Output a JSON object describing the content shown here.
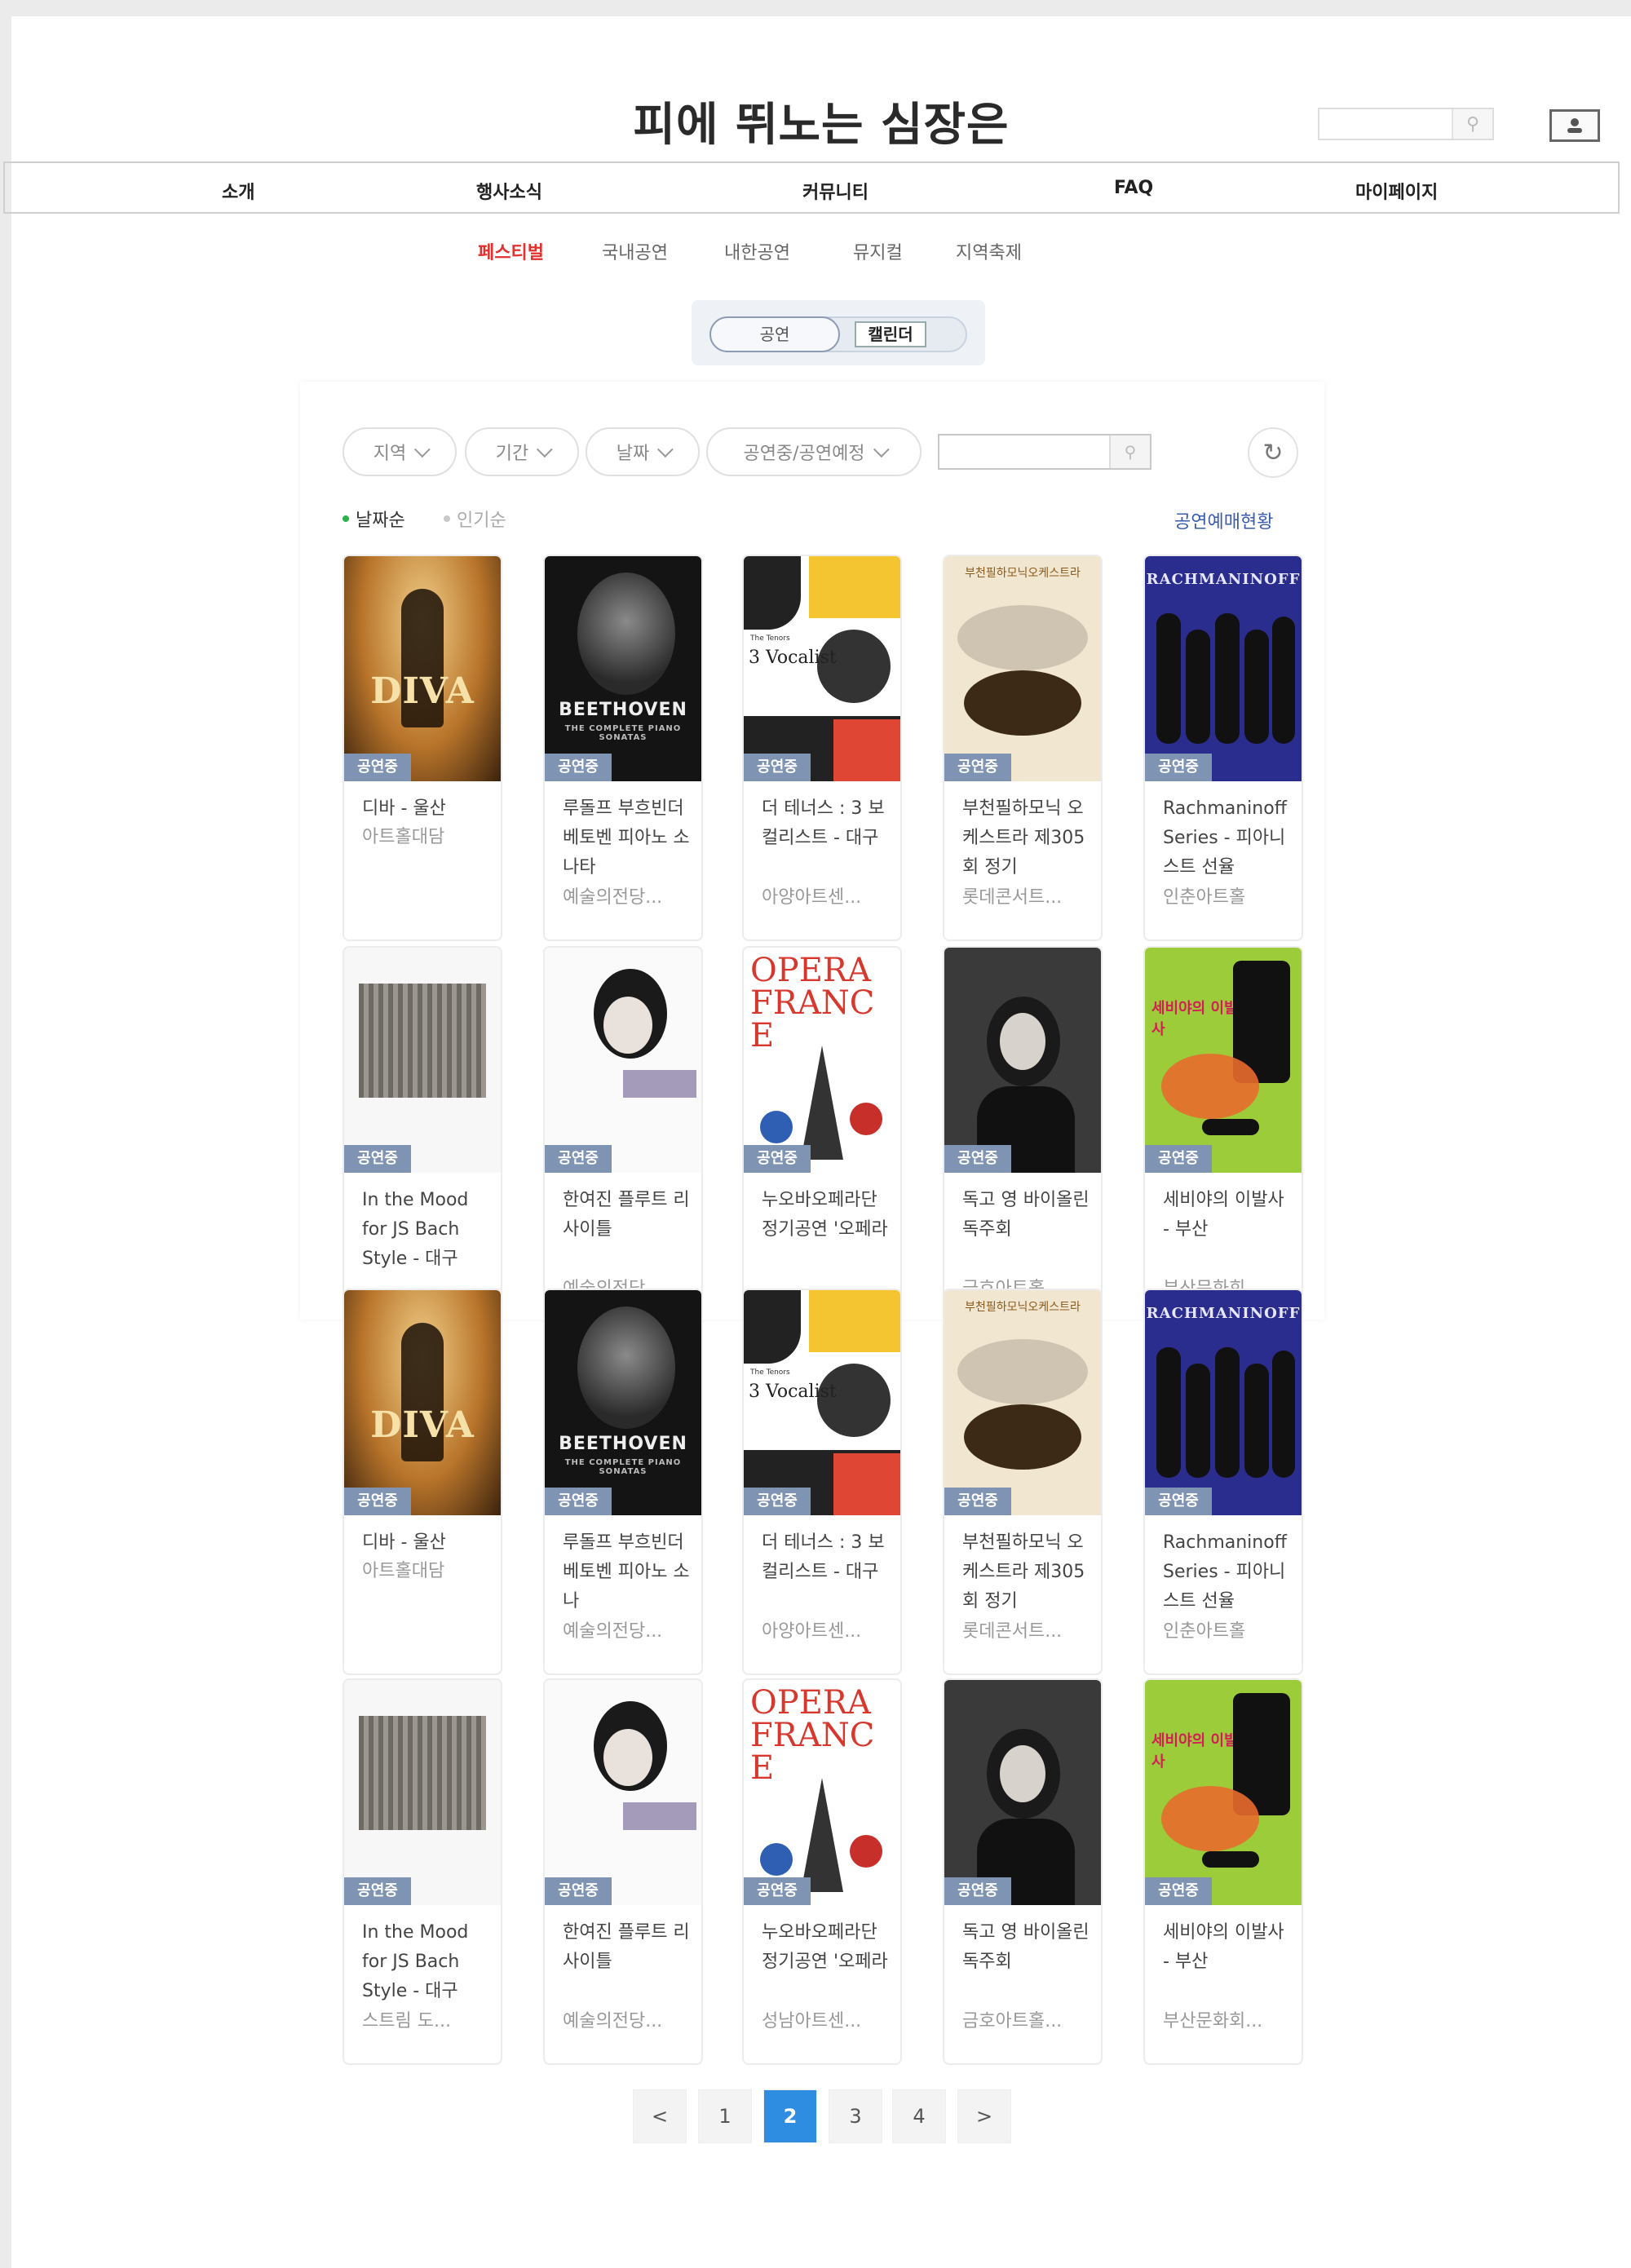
{
  "header": {
    "site_title": "피에 뛰노는 심장은"
  },
  "gnb": [
    "소개",
    "행사소식",
    "커뮤니티",
    "FAQ",
    "마이페이지"
  ],
  "subnav": {
    "items": [
      "페스티벌",
      "국내공연",
      "내한공연",
      "뮤지컬",
      "지역축제"
    ],
    "active_index": 0
  },
  "view_toggle": {
    "on": "공연",
    "off": "캘린더"
  },
  "filters": {
    "region": "지역",
    "period": "기간",
    "date": "날짜",
    "status": "공연중/공연예정"
  },
  "sort": {
    "by_date": "날짜순",
    "by_popularity": "인기순"
  },
  "status_link": "공연예매현황",
  "cards": [
    {
      "title": "디바 - 울산",
      "venue": "아트홀대담",
      "badge": "공연중",
      "poster": "diva"
    },
    {
      "title": "루돌프 부흐빈더 베토벤 피아노 소나타",
      "venue": "예술의전당...",
      "badge": "공연중",
      "poster": "beethoven"
    },
    {
      "title": "더 테너스 : 3 보컬리스트 - 대구",
      "venue": "아양아트센...",
      "badge": "공연중",
      "poster": "vocalist"
    },
    {
      "title": "부천필하모닉 오케스트라 제305회 정기",
      "venue": "롯데콘서트...",
      "badge": "공연중",
      "poster": "bucheon"
    },
    {
      "title": "Rachmaninoff Series - 피아니스트 선율",
      "venue": "인춘아트홀",
      "badge": "공연중",
      "poster": "rach"
    },
    {
      "title": "In the Mood for JS Bach Style - 대구",
      "venue": "",
      "badge": "공연중",
      "poster": "bach"
    },
    {
      "title": "한여진 플루트 리사이틀",
      "venue": "예술의전당...",
      "badge": "공연중",
      "poster": "flute"
    },
    {
      "title": "누오바오페라단 정기공연 '오페라",
      "venue": "",
      "badge": "공연중",
      "poster": "opera"
    },
    {
      "title": "독고 영 바이올린 독주회",
      "venue": "금호아트홀...",
      "badge": "공연중",
      "poster": "violin"
    },
    {
      "title": "세비야의 이발사 - 부산",
      "venue": "부산문화회...",
      "badge": "공연중",
      "poster": "seville"
    },
    {
      "title": "디바 - 울산",
      "venue": "아트홀대담",
      "badge": "공연중",
      "poster": "diva"
    },
    {
      "title": "루돌프 부흐빈더 베토벤 피아노 소나",
      "venue": "예술의전당...",
      "badge": "공연중",
      "poster": "beethoven"
    },
    {
      "title": "더 테너스 : 3 보컬리스트 - 대구",
      "venue": "아양아트센...",
      "badge": "공연중",
      "poster": "vocalist"
    },
    {
      "title": "부천필하모닉 오케스트라 제305회 정기",
      "venue": "롯데콘서트...",
      "badge": "공연중",
      "poster": "bucheon"
    },
    {
      "title": "Rachmaninoff Series - 피아니스트 선율",
      "venue": "인춘아트홀",
      "badge": "공연중",
      "poster": "rach"
    },
    {
      "title": "In the Mood for JS Bach Style - 대구",
      "venue": "스트림 도...",
      "badge": "공연중",
      "poster": "bach"
    },
    {
      "title": "한여진 플루트 리사이틀",
      "venue": "예술의전당...",
      "badge": "공연중",
      "poster": "flute"
    },
    {
      "title": "누오바오페라단 정기공연 '오페라",
      "venue": "성남아트센...",
      "badge": "공연중",
      "poster": "opera"
    },
    {
      "title": "독고 영 바이올린 독주회",
      "venue": "금호아트홀...",
      "badge": "공연중",
      "poster": "violin"
    },
    {
      "title": "세비야의 이발사 - 부산",
      "venue": "부산문화회...",
      "badge": "공연중",
      "poster": "seville"
    }
  ],
  "poster_text": {
    "diva": "DIVA",
    "beethoven": "BEETHOVEN",
    "beethoven_sub": "THE COMPLETE PIANO SONATAS",
    "vocalist": "3 Vocalist",
    "vocalist_pre": "The Tenors",
    "bucheon": "부천필하모닉오케스트라",
    "rach": "RACHMANINOFF",
    "opera": "OPERA FRANCE",
    "seville": "세비야의 이발사"
  },
  "pagination": {
    "prev": "<",
    "next": ">",
    "pages": [
      "1",
      "2",
      "3",
      "4"
    ],
    "active": "2"
  },
  "colors": {
    "accent_red": "#e0312d",
    "badge": "#7f93b3",
    "active_page": "#2e8de0",
    "link_blue": "#3a5bb0",
    "sort_active_dot": "#2bb24c"
  }
}
